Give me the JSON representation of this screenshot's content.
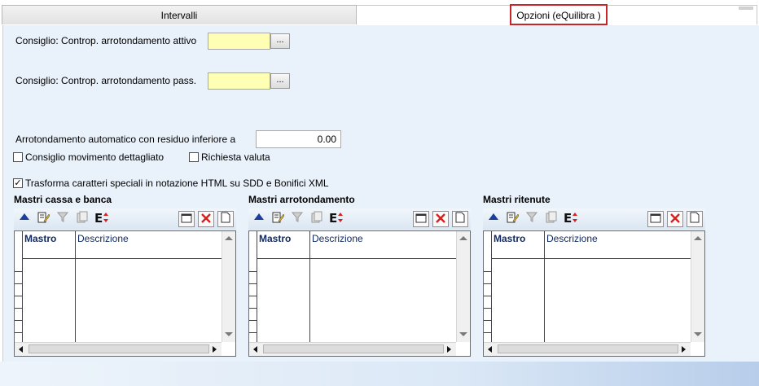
{
  "tabs": {
    "left": "Intervalli",
    "right": "Opzioni (eQuilibra )"
  },
  "form": {
    "contropartita_attivo_label": "Consiglio: Controp. arrotondamento attivo",
    "contropartita_passivo_label": "Consiglio: Controp. arrotondamento pass.",
    "ellipsis": "...",
    "arrotondamento_label": "Arrotondamento automatico con residuo inferiore a",
    "arrotondamento_value": "0.00",
    "movimento_dettagliato_label": "Consiglio movimento dettagliato",
    "richiesta_valuta_label": "Richiesta valuta",
    "trasforma_label": "Trasforma caratteri speciali in notazione HTML su SDD e Bonifici XML",
    "trasforma_checked": "✓"
  },
  "grids": [
    {
      "title": "Mastri cassa e banca",
      "col_mastro": "Mastro",
      "col_descrizione": "Descrizione"
    },
    {
      "title": "Mastri arrotondamento",
      "col_mastro": "Mastro",
      "col_descrizione": "Descrizione"
    },
    {
      "title": "Mastri ritenute",
      "col_mastro": "Mastro",
      "col_descrizione": "Descrizione"
    }
  ],
  "toolbar_icons": [
    "move-up-icon",
    "edit-list-icon",
    "filter-icon",
    "copy-icon",
    "export-sort-icon",
    "window-icon",
    "delete-icon",
    "new-document-icon"
  ],
  "colors": {
    "panel": "#e9f1fa",
    "yellow_field": "#fffeb5",
    "active_tab_highlight": "#c8252a",
    "delete_red": "#d42020",
    "up_blue": "#1c3e9c"
  }
}
